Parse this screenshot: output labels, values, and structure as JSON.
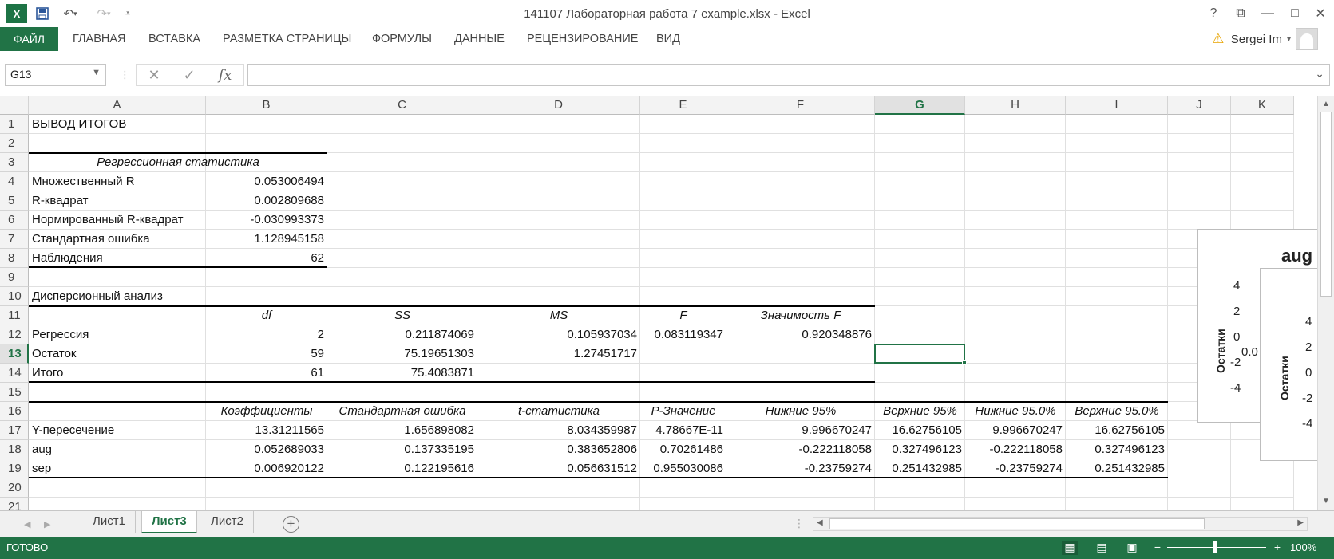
{
  "title_bar": {
    "title": "141107 Лабораторная работа 7 example.xlsx - Excel",
    "app_icon": "X",
    "buttons": [
      "?",
      "⧉",
      "—",
      "□",
      "✕"
    ]
  },
  "ribbon": {
    "file_tab": "ФАЙЛ",
    "tabs": [
      "ГЛАВНАЯ",
      "ВСТАВКА",
      "РАЗМЕТКА СТРАНИЦЫ",
      "ФОРМУЛЫ",
      "ДАННЫЕ",
      "РЕЦЕНЗИРОВАНИЕ",
      "ВИД"
    ],
    "user_name": "Sergei Im"
  },
  "formula_bar": {
    "name_box": "G13",
    "formula": ""
  },
  "columns": [
    "A",
    "B",
    "C",
    "D",
    "E",
    "F",
    "G",
    "H",
    "I",
    "J",
    "K"
  ],
  "selected_column": "G",
  "rows": [
    "1",
    "2",
    "3",
    "4",
    "5",
    "6",
    "7",
    "8",
    "9",
    "10",
    "11",
    "12",
    "13",
    "14",
    "15",
    "16",
    "17",
    "18",
    "19",
    "20",
    "21"
  ],
  "selected_row": "13",
  "cells": {
    "A1": "ВЫВОД ИТОГОВ",
    "A3": "Регрессионная статистика",
    "A4": "Множественный R",
    "B4": "0.053006494",
    "A5": "R-квадрат",
    "B5": "0.002809688",
    "A6": "Нормированный R-квадрат",
    "B6": "-0.030993373",
    "A7": "Стандартная ошибка",
    "B7": "1.128945158",
    "A8": "Наблюдения",
    "B8": "62",
    "A10": "Дисперсионный анализ",
    "B11": "df",
    "C11": "SS",
    "D11": "MS",
    "E11": "F",
    "F11": "Значимость F",
    "A12": "Регрессия",
    "B12": "2",
    "C12": "0.211874069",
    "D12": "0.105937034",
    "E12": "0.083119347",
    "F12": "0.920348876",
    "A13": "Остаток",
    "B13": "59",
    "C13": "75.19651303",
    "D13": "1.27451717",
    "A14": "Итого",
    "B14": "61",
    "C14": "75.4083871",
    "B16": "Коэффициенты",
    "C16": "Стандартная ошибка",
    "D16": "t-статистика",
    "E16": "P-Значение",
    "F16": "Нижние 95%",
    "G16": "Верхние 95%",
    "H16": "Нижние 95.0%",
    "I16": "Верхние 95.0%",
    "A17": "Y-пересечение",
    "B17": "13.31211565",
    "C17": "1.656898082",
    "D17": "8.034359987",
    "E17": "4.78667E-11",
    "F17": "9.996670247",
    "G17": "16.62756105",
    "H17": "9.996670247",
    "I17": "16.62756105",
    "A18": "aug",
    "B18": "0.052689033",
    "C18": "0.137335195",
    "D18": "0.383652806",
    "E18": "0.70261486",
    "F18": "-0.222118058",
    "G18": "0.327496123",
    "H18": "-0.222118058",
    "I18": "0.327496123",
    "A19": "sep",
    "B19": "0.006920122",
    "C19": "0.122195616",
    "D19": "0.056631512",
    "E19": "0.955030086",
    "F19": "-0.23759274",
    "G19": "0.251432985",
    "H19": "-0.23759274",
    "I19": "0.251432985"
  },
  "charts": {
    "chart1": {
      "title": "aug",
      "ylabel": "Остатки",
      "yticks": [
        "4",
        "2",
        "0",
        "-2",
        "-4"
      ],
      "x_partial": "0.0"
    },
    "chart2": {
      "ylabel": "Остатки",
      "yticks": [
        "4",
        "2",
        "0",
        "-2",
        "-4"
      ],
      "x_partial": "0"
    }
  },
  "sheets": {
    "tabs": [
      "Лист1",
      "Лист3",
      "Лист2"
    ],
    "active": "Лист3"
  },
  "status": {
    "text": "ГОТОВО",
    "zoom": "100%",
    "accent": "#217346"
  }
}
